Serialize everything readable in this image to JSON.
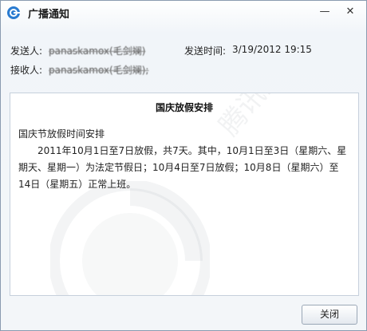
{
  "window": {
    "title": "广播通知",
    "minimize_symbol": "—",
    "close_symbol": "✕"
  },
  "header": {
    "sender_label": "发送人:",
    "sender_value": "panaskamox(毛剑斓)",
    "time_label": "发送时间:",
    "time_value": "3/19/2012 19:15",
    "recipient_label": "接收人:",
    "recipient_value": "panaskamox(毛剑斓);"
  },
  "notice": {
    "title": "国庆放假安排",
    "subtitle": "国庆节放假时间安排",
    "body": "2011年10月1日至7日放假，共7天。其中，10月1日至3日（星期六、星期天、星期一）为法定节假日；10月4日至7日放假；10月8日（星期六）至14日（星期五）正常上班。",
    "watermark": "腾讯企业QQ  b.qq.com"
  },
  "footer": {
    "close_label": "关闭"
  },
  "icons": {
    "app": "qq-broadcast-icon",
    "minimize": "minimize-icon",
    "close": "close-icon"
  },
  "colors": {
    "accent": "#1a6fc4",
    "border": "#8a9bb0"
  }
}
